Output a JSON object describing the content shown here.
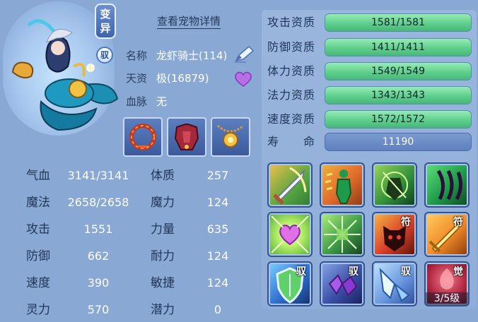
{
  "pet": {
    "badge_mutation": "变异",
    "badge_ride": "驭",
    "detail_link": "查看宠物详情",
    "name_label": "名称",
    "name_value": "龙虾骑士(114)",
    "talent_label": "天资",
    "talent_value": "极(16879)",
    "bloodline_label": "血脉",
    "bloodline_value": "无",
    "icons": [
      "edit-pen-icon",
      "heart-icon"
    ]
  },
  "equipment": [
    {
      "name": "collar-equip-icon"
    },
    {
      "name": "armor-equip-icon"
    },
    {
      "name": "amulet-equip-icon"
    }
  ],
  "stats": {
    "left": [
      {
        "label": "气血",
        "value": "3141/3141"
      },
      {
        "label": "魔法",
        "value": "2658/2658"
      },
      {
        "label": "攻击",
        "value": "1551"
      },
      {
        "label": "防御",
        "value": "662"
      },
      {
        "label": "速度",
        "value": "390"
      },
      {
        "label": "灵力",
        "value": "570"
      }
    ],
    "right": [
      {
        "label": "体质",
        "value": "257"
      },
      {
        "label": "魔力",
        "value": "124"
      },
      {
        "label": "力量",
        "value": "635"
      },
      {
        "label": "耐力",
        "value": "124"
      },
      {
        "label": "敏捷",
        "value": "124"
      },
      {
        "label": "潜力",
        "value": "0"
      }
    ]
  },
  "aptitudes": [
    {
      "label": "攻击资质",
      "value": "1581/1581"
    },
    {
      "label": "防御资质",
      "value": "1411/1411"
    },
    {
      "label": "体力资质",
      "value": "1549/1549"
    },
    {
      "label": "法力资质",
      "value": "1343/1343"
    },
    {
      "label": "速度资质",
      "value": "1572/1572"
    }
  ],
  "lifespan": {
    "label": "寿　　命",
    "value": "11190"
  },
  "skills": [
    {
      "name": "sword-strike-skill-icon"
    },
    {
      "name": "phantom-figure-skill-icon"
    },
    {
      "name": "green-shadow-skill-icon"
    },
    {
      "name": "claw-swipe-skill-icon"
    },
    {
      "name": "heart-shine-skill-icon"
    },
    {
      "name": "crystal-shards-skill-icon"
    },
    {
      "name": "demon-face-skill-icon",
      "corner": "符"
    },
    {
      "name": "golden-sword-skill-icon",
      "corner": "符"
    },
    {
      "name": "shield-skill-icon",
      "corner": "驭"
    },
    {
      "name": "purple-gem-skill-icon",
      "corner": "驭"
    },
    {
      "name": "ice-crystal-skill-icon",
      "corner": "驭"
    },
    {
      "name": "awaken-skill-icon",
      "corner": "觉",
      "level": "3/5级"
    }
  ],
  "colors": {
    "background": "#89a8d4",
    "aptitude_bar": "#5fcf8c",
    "life_bar": "#6b8ac8"
  }
}
